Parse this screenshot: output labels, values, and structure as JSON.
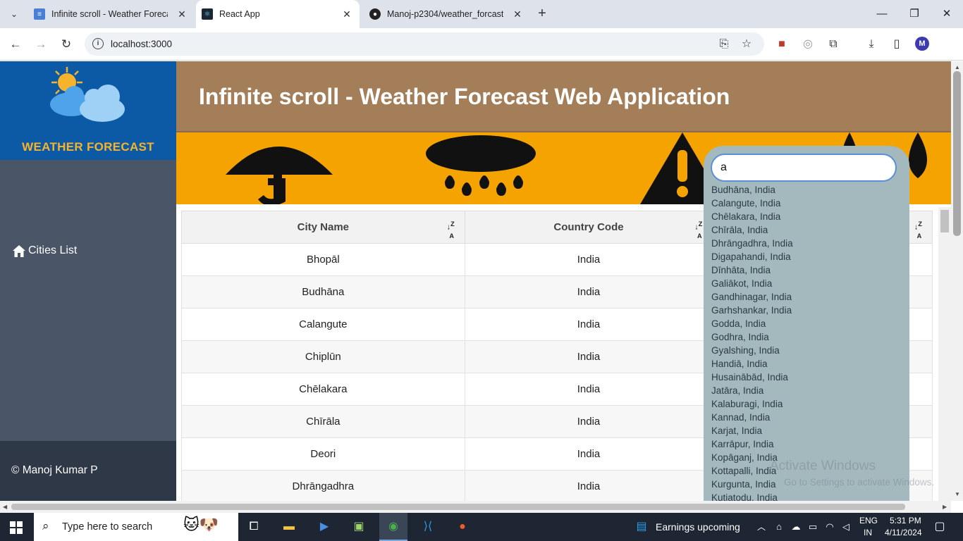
{
  "browser": {
    "tabs": [
      {
        "title": "Infinite scroll - Weather Forecast",
        "active": false
      },
      {
        "title": "React App",
        "active": true
      },
      {
        "title": "Manoj-p2304/weather_forcast",
        "active": false
      }
    ],
    "url": "localhost:3000",
    "profile_initial": "M"
  },
  "sidebar": {
    "logo_text": "WEATHER FORECAST",
    "nav_items": [
      {
        "label": "Cities List",
        "icon": "home-icon"
      }
    ],
    "footer": "© Manoj Kumar P"
  },
  "header": {
    "title": "Infinite scroll - Weather Forecast Web Application"
  },
  "table": {
    "columns": [
      "City Name",
      "Country Code",
      ""
    ],
    "rows": [
      {
        "city": "Bhopāl",
        "country": "India"
      },
      {
        "city": "Budhāna",
        "country": "India"
      },
      {
        "city": "Calangute",
        "country": "India"
      },
      {
        "city": "Chiplūn",
        "country": "India"
      },
      {
        "city": "Chēlakara",
        "country": "India"
      },
      {
        "city": "Chīrāla",
        "country": "India"
      },
      {
        "city": "Deori",
        "country": "India"
      },
      {
        "city": "Dhrāngadhra",
        "country": "India"
      }
    ]
  },
  "search": {
    "value": "a",
    "suggestions": [
      "Budhāna, India",
      "Calangute, India",
      "Chēlakara, India",
      "Chīrāla, India",
      "Dhrāngadhra, India",
      "Digapahandi, India",
      "Dīnhāta, India",
      "Galiākot, India",
      "Gandhinagar, India",
      "Garhshankar, India",
      "Godda, India",
      "Godhra, India",
      "Gyalshing, India",
      "Handiā, India",
      "Husainābād, India",
      "Jatāra, India",
      "Kalaburagi, India",
      "Kannad, India",
      "Karjat, India",
      "Karrāpur, India",
      "Kopāganj, India",
      "Kottapalli, India",
      "Kurgunta, India",
      "Kutiatodu, India"
    ]
  },
  "watermark": {
    "line1": "Activate Windows",
    "line2": "Go to Settings to activate Windows."
  },
  "taskbar": {
    "search_placeholder": "Type here to search",
    "news": "Earnings upcoming",
    "lang1": "ENG",
    "lang2": "IN",
    "time": "5:31 PM",
    "date": "4/11/2024"
  },
  "colors": {
    "sidebar": "#4a5567",
    "logo_bg": "#0c5aa6",
    "header": "#a47e58",
    "banner": "#f5a300",
    "dropdown": "#a3b9bd"
  }
}
